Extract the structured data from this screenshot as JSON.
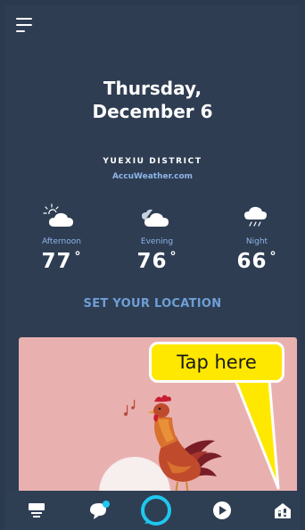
{
  "header": {
    "date_line1": "Thursday,",
    "date_line2": "December 6"
  },
  "weather": {
    "location": "YUEXIU DISTRICT",
    "provider": "AccuWeather.com",
    "forecast": [
      {
        "period": "Afternoon",
        "temp": "77",
        "icon": "partly-sunny-icon"
      },
      {
        "period": "Evening",
        "temp": "76",
        "icon": "cloudy-night-icon"
      },
      {
        "period": "Night",
        "temp": "66",
        "icon": "rain-cloud-icon"
      }
    ],
    "degree_symbol": "°",
    "set_location_label": "SET YOUR LOCATION"
  },
  "callout": {
    "label": "Tap here"
  },
  "nav": {
    "items": [
      {
        "name": "home",
        "icon": "home-feed-icon"
      },
      {
        "name": "communicate",
        "icon": "chat-bubble-icon"
      },
      {
        "name": "alexa",
        "icon": "alexa-ring-icon"
      },
      {
        "name": "play",
        "icon": "play-icon"
      },
      {
        "name": "devices",
        "icon": "smart-home-devices-icon"
      }
    ]
  },
  "colors": {
    "background": "#2e3d52",
    "accent_blue": "#6e9fd6",
    "alexa_cyan": "#1fc7ef",
    "card_pink": "#e8b1b0",
    "callout_yellow": "#ffe800"
  }
}
